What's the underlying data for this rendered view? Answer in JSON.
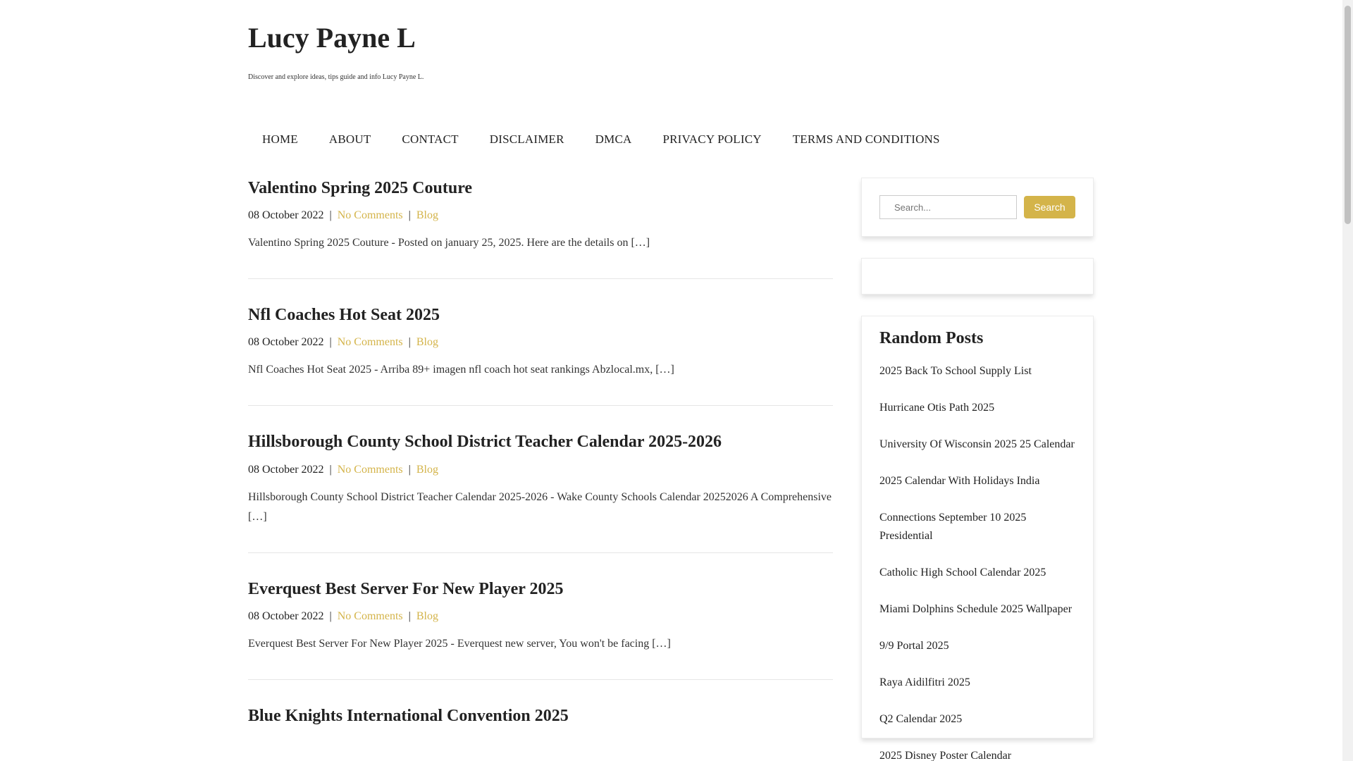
{
  "site": {
    "title": "Lucy Payne L",
    "description": "Discover and explore ideas, tips guide and info Lucy Payne L."
  },
  "nav": {
    "items": [
      "HOME",
      "ABOUT",
      "CONTACT",
      "DISCLAIMER",
      "DMCA",
      "PRIVACY POLICY",
      "TERMS AND CONDITIONS"
    ]
  },
  "colors": {
    "accent": "#d4b44a",
    "text": "#222222"
  },
  "posts": [
    {
      "title": "Valentino Spring 2025 Couture",
      "date": "08 October 2022",
      "comments": "No Comments",
      "category": "Blog",
      "excerpt": "Valentino Spring 2025 Couture - Posted on january 25, 2025. Here are the details on […]"
    },
    {
      "title": "Nfl Coaches Hot Seat 2025",
      "date": "08 October 2022",
      "comments": "No Comments",
      "category": "Blog",
      "excerpt": "Nfl Coaches Hot Seat 2025 - Arriba 89+ imagen nfl coach hot seat rankings Abzlocal.mx, […]"
    },
    {
      "title": "Hillsborough County School District Teacher Calendar 2025-2026",
      "date": "08 October 2022",
      "comments": "No Comments",
      "category": "Blog",
      "excerpt": "Hillsborough County School District Teacher Calendar 2025-2026 - Wake County Schools Calendar 20252026 A Comprehensive […]"
    },
    {
      "title": "Everquest Best Server For New Player 2025",
      "date": "08 October 2022",
      "comments": "No Comments",
      "category": "Blog",
      "excerpt": "Everquest Best Server For New Player 2025 - Everquest new server, You won't be facing […]"
    },
    {
      "title": "Blue Knights International Convention 2025",
      "date": "",
      "comments": "",
      "category": "",
      "excerpt": ""
    }
  ],
  "sidebar": {
    "search": {
      "placeholder": "Search...",
      "button_label": "Search"
    },
    "random_posts": {
      "title": "Random Posts",
      "items": [
        "2025 Back To School Supply List",
        "Hurricane Otis Path 2025",
        "University Of Wisconsin 2025 25 Calendar",
        "2025 Calendar With Holidays India",
        "Connections September 10 2025 Presidential",
        "Catholic High School Calendar 2025",
        "Miami Dolphins Schedule 2025 Wallpaper",
        "9/9 Portal 2025",
        "Raya Aidilfitri 2025",
        "Q2 Calendar 2025",
        "2025 Disney Poster Calendar"
      ]
    }
  }
}
